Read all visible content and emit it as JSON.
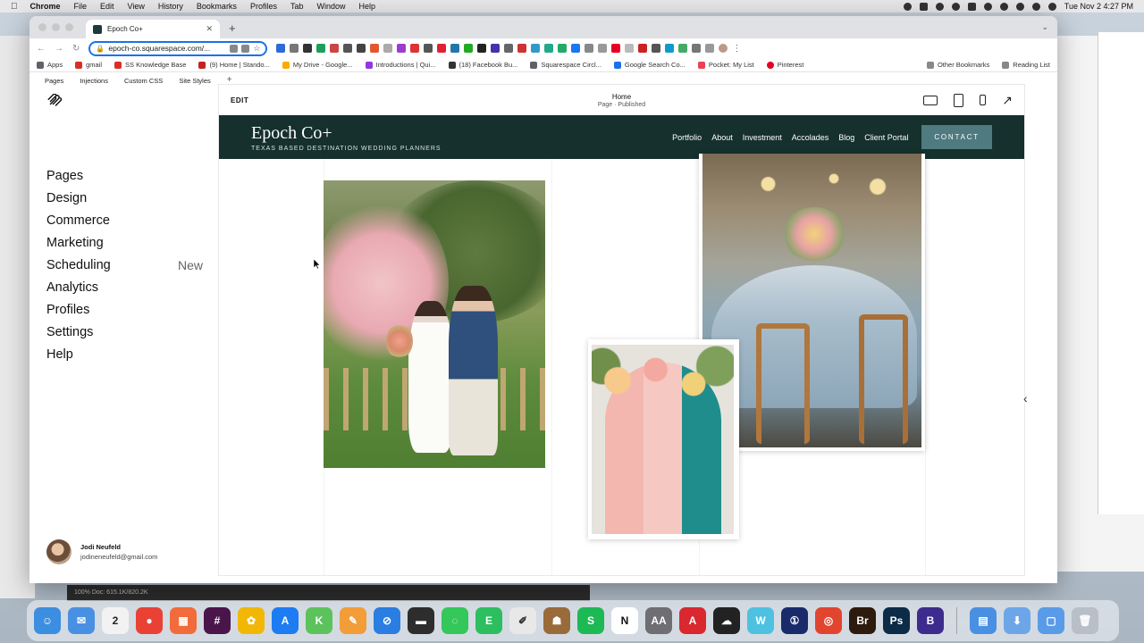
{
  "menubar": {
    "app_name": "Chrome",
    "menus": [
      "File",
      "Edit",
      "View",
      "History",
      "Bookmarks",
      "Profiles",
      "Tab",
      "Window",
      "Help"
    ],
    "clock": "Tue Nov 2  4:27 PM"
  },
  "browser": {
    "tab_title": "Epoch Co+",
    "new_tab_symbol": "+",
    "url": "epoch-co.squarespace.com/...",
    "bookmarks": [
      {
        "label": "Apps",
        "color": "#5f6368"
      },
      {
        "label": "gmail",
        "color": "#d93025"
      },
      {
        "label": "SS Knowledge Base",
        "color": "#d93025"
      },
      {
        "label": "(9) Home | Stando...",
        "color": "#c5221f"
      },
      {
        "label": "My Drive - Google...",
        "color": "#f9ab00"
      },
      {
        "label": "Introductions | Qui...",
        "color": "#9334e6"
      },
      {
        "label": "(18) Facebook Bu...",
        "color": "#333333"
      },
      {
        "label": "Squarespace Circl...",
        "color": "#5f6368"
      },
      {
        "label": "Google Search Co...",
        "color": "#1a73e8"
      },
      {
        "label": "Pocket: My List",
        "color": "#ef4056"
      },
      {
        "label": "Pinterest",
        "color": "#e60023"
      }
    ],
    "other_bookmarks": "Other Bookmarks",
    "reading_list": "Reading List"
  },
  "squarespace": {
    "top_tabs": [
      "Pages",
      "Injections",
      "Custom CSS",
      "Site Styles"
    ],
    "nav": [
      {
        "label": "Pages",
        "badge": ""
      },
      {
        "label": "Design",
        "badge": ""
      },
      {
        "label": "Commerce",
        "badge": ""
      },
      {
        "label": "Marketing",
        "badge": ""
      },
      {
        "label": "Scheduling",
        "badge": "New"
      },
      {
        "label": "Analytics",
        "badge": ""
      },
      {
        "label": "Profiles",
        "badge": ""
      },
      {
        "label": "Settings",
        "badge": ""
      },
      {
        "label": "Help",
        "badge": ""
      }
    ],
    "user": {
      "name": "Jodi Neufeld",
      "email": "jodineneufeld@gmail.com"
    }
  },
  "preview": {
    "edit_label": "EDIT",
    "page_title": "Home",
    "page_status": "Page · Published",
    "site": {
      "logo": "Epoch Co+",
      "tagline": "TEXAS BASED DESTINATION WEDDING PLANNERS",
      "nav": [
        "Portfolio",
        "About",
        "Investment",
        "Accolades",
        "Blog",
        "Client Portal"
      ],
      "cta": "CONTACT",
      "header_color": "#15302d",
      "cta_color": "#4f7a7f"
    },
    "images": [
      {
        "icon": "wedding-couple-photo"
      },
      {
        "icon": "reception-table-photo"
      },
      {
        "icon": "seating-chart-arch-photo"
      }
    ]
  },
  "background": {
    "ps_status": "100%        Doc: 615.1K/820.2K"
  },
  "dock": {
    "apps": [
      {
        "label": "☺",
        "color": "#3b8ee0"
      },
      {
        "label": "✉",
        "color": "#4a90e2"
      },
      {
        "label": "2",
        "color": "#f2f2f2"
      },
      {
        "label": "●",
        "color": "#e94235"
      },
      {
        "label": "▦",
        "color": "#f26b3a"
      },
      {
        "label": "#",
        "color": "#4a154b"
      },
      {
        "label": "✿",
        "color": "#f2b705"
      },
      {
        "label": "A",
        "color": "#1d7cf2"
      },
      {
        "label": "K",
        "color": "#5cc35c"
      },
      {
        "label": "✎",
        "color": "#f29d38"
      },
      {
        "label": "⊘",
        "color": "#2a7de1"
      },
      {
        "label": "▬",
        "color": "#2d2d2d"
      },
      {
        "label": "◌",
        "color": "#34c759"
      },
      {
        "label": "E",
        "color": "#2dbe60"
      },
      {
        "label": "✐",
        "color": "#e8e8e8"
      },
      {
        "label": "☗",
        "color": "#9a6b3a"
      },
      {
        "label": "S",
        "color": "#1db954"
      },
      {
        "label": "N",
        "color": "#ffffff"
      },
      {
        "label": "AA",
        "color": "#6e6e73"
      },
      {
        "label": "A",
        "color": "#d9282f"
      },
      {
        "label": "☁",
        "color": "#222222"
      },
      {
        "label": "W",
        "color": "#4ec1e0"
      },
      {
        "label": "①",
        "color": "#1a2b6b"
      },
      {
        "label": "◎",
        "color": "#e2452f"
      },
      {
        "label": "Br",
        "color": "#2d1b0e"
      },
      {
        "label": "Ps",
        "color": "#0b2b47"
      },
      {
        "label": "B",
        "color": "#3d2c8d"
      },
      {
        "label": "▤",
        "color": "#4a90e2"
      },
      {
        "label": "⬇",
        "color": "#6da6e8"
      },
      {
        "label": "▢",
        "color": "#5a9be8"
      },
      {
        "label": "🗑",
        "color": "#b8bfc8"
      }
    ]
  }
}
